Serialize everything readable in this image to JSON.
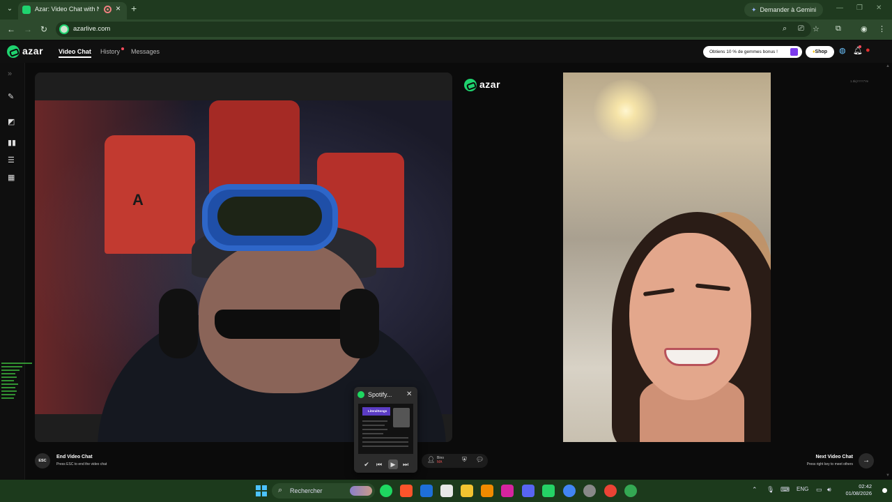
{
  "browser": {
    "tab_title": "Azar: Video Chat with New",
    "url": "azarlive.com",
    "gemini_label": "Demander à Gemini"
  },
  "app": {
    "logo_text": "azar",
    "nav": {
      "video_chat": "Video Chat",
      "history": "History",
      "messages": "Messages"
    },
    "promo_text": "Obtiens 10 % de gemmes bonus !",
    "shop_label": "Shop"
  },
  "remote": {
    "id_text": "1.5kjYYY7Ye"
  },
  "controls": {
    "esc_label": "ESC",
    "end_title": "End Video Chat",
    "end_sub": "Press ESC to end the video chat",
    "next_title": "Next Video Chat",
    "next_sub": "Press right key to meet others",
    "country_name": "Bino",
    "country_code": "MA"
  },
  "spotify": {
    "title": "Spotify...",
    "banner": "LiteralSongs"
  },
  "taskbar": {
    "search_placeholder": "Rechercher",
    "language": "ENG",
    "time": "02:42",
    "date": "01/08/2026"
  },
  "colors": {
    "brand": "#1fd36f",
    "chrome_green": "#2d4a2d",
    "taskbar": "#1c3a1c",
    "spotify": "#1ed760"
  }
}
